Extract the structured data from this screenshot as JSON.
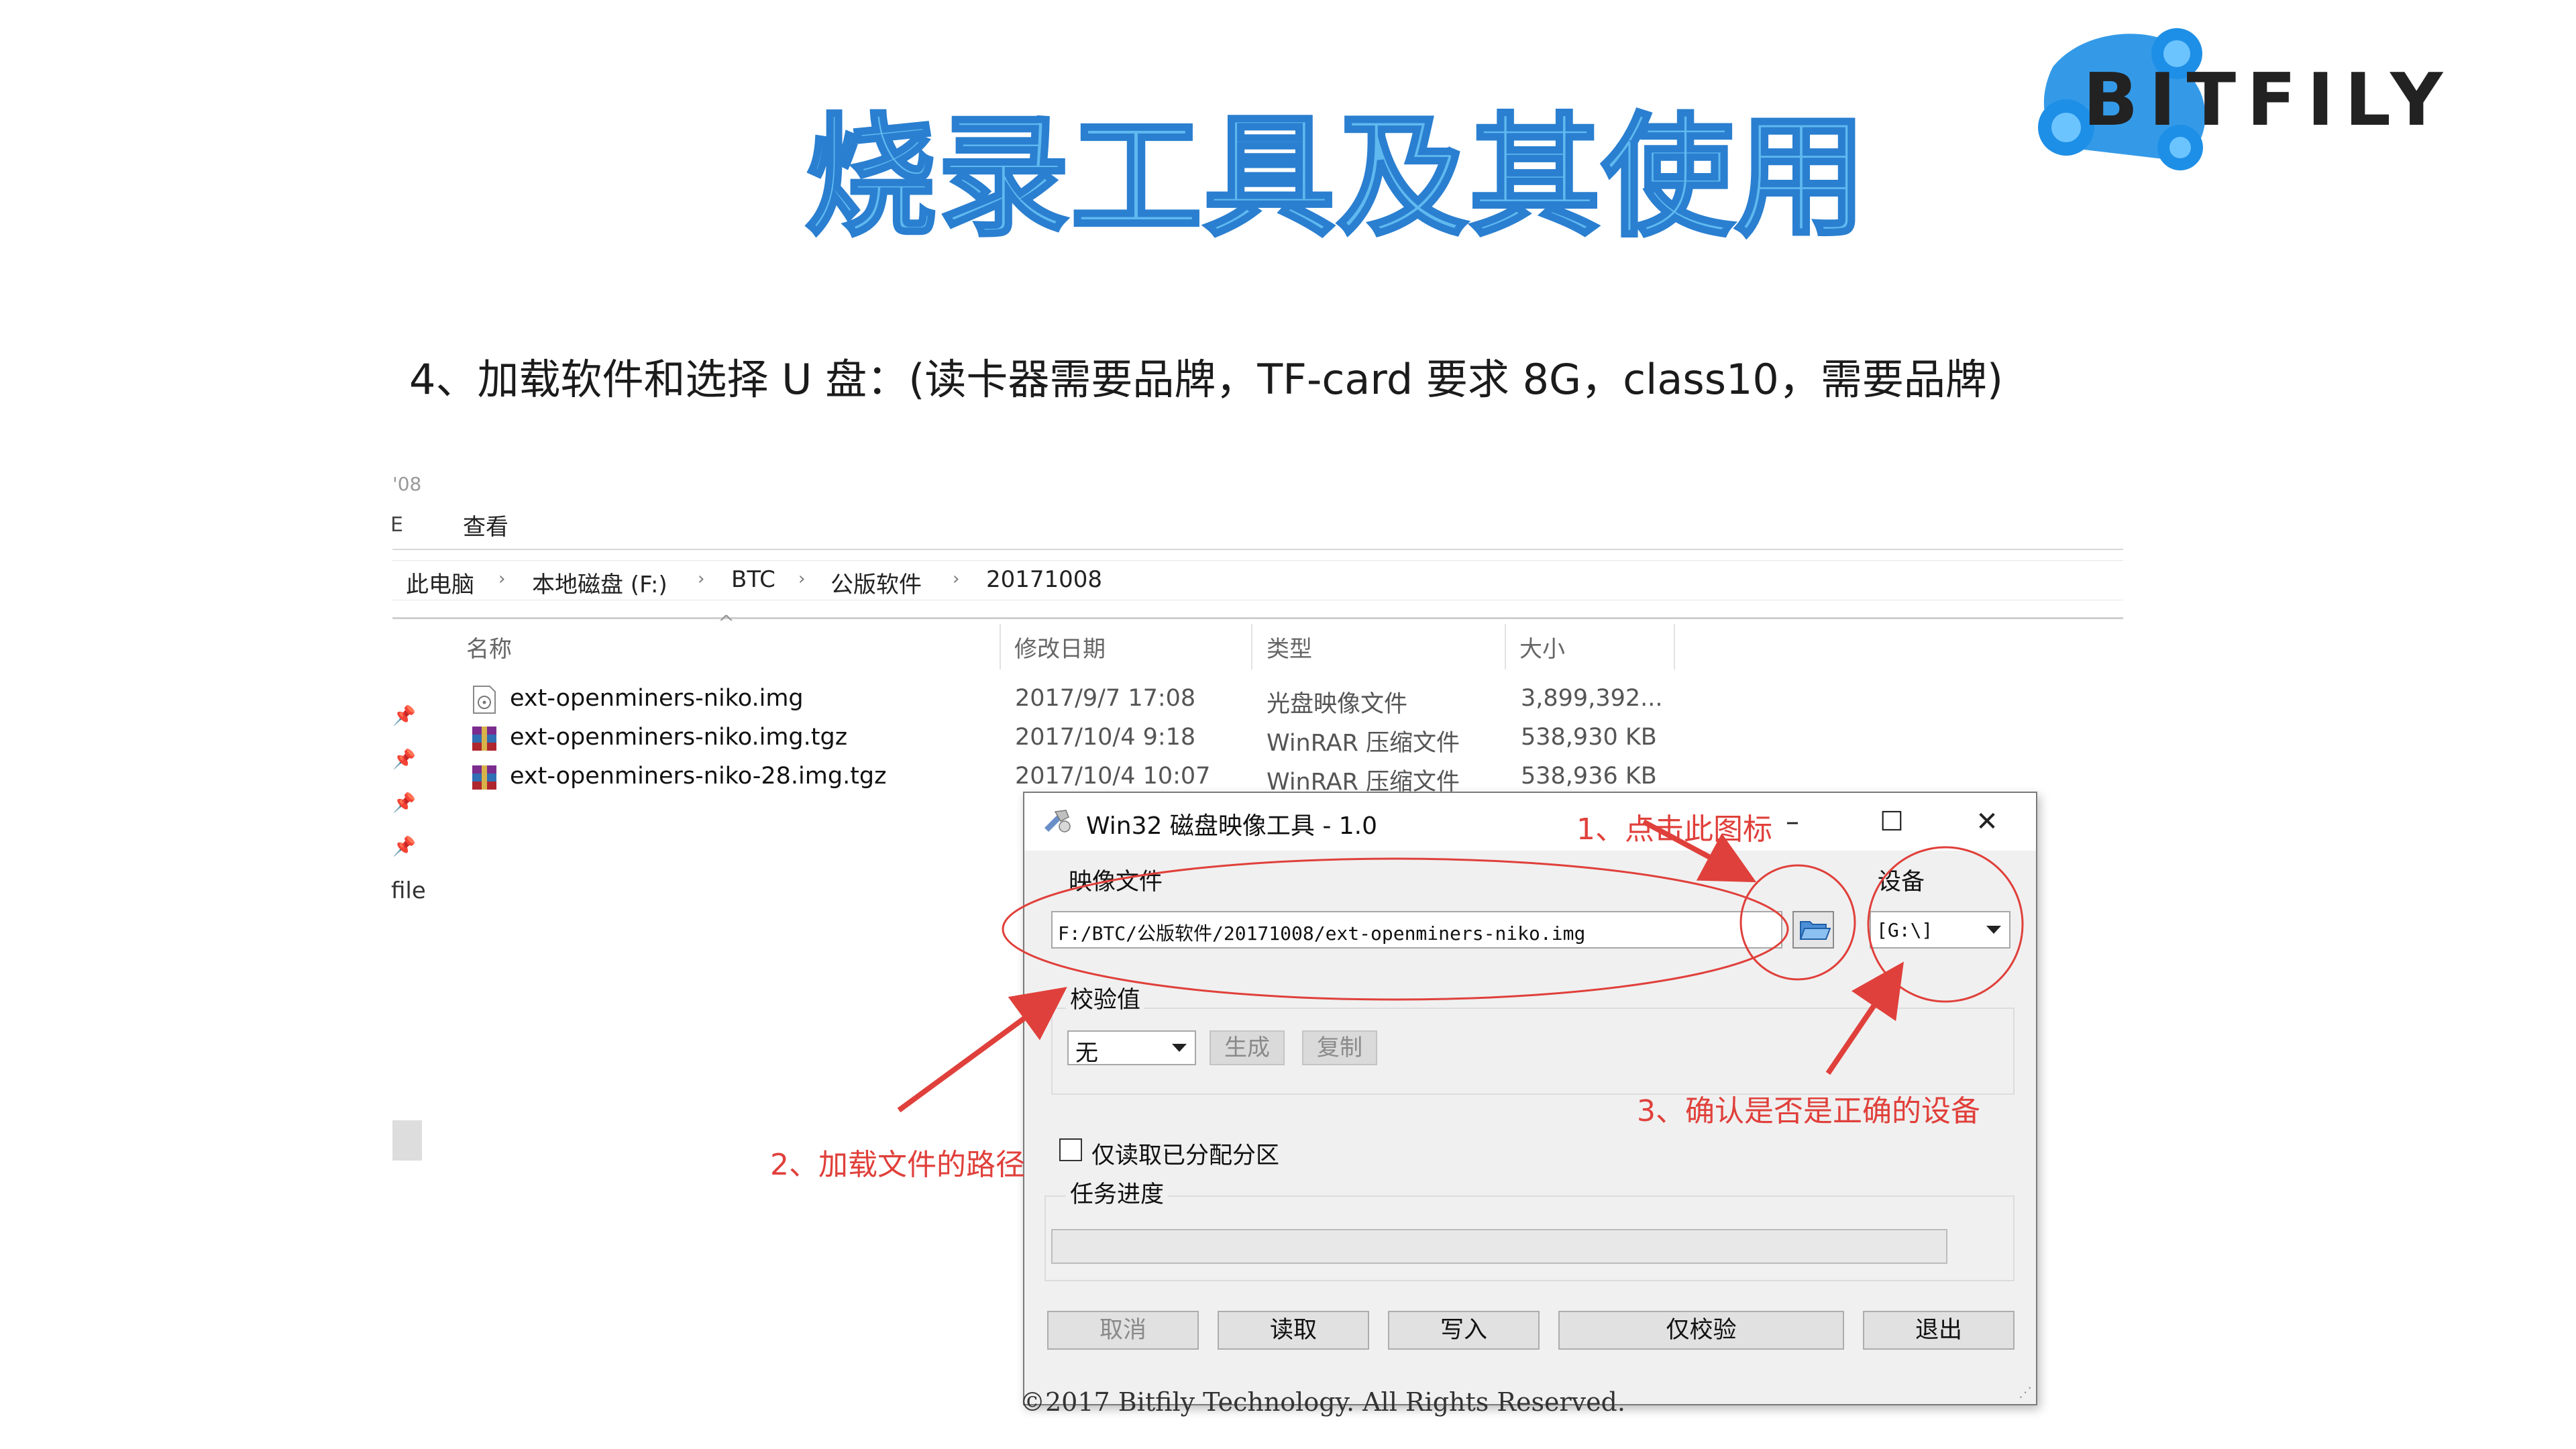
{
  "slide": {
    "title": "烧录工具及其使用",
    "subtitle": "4、加载软件和选择 U 盘：(读卡器需要品牌，TF-card 要求 8G，class10，需要品牌)",
    "logo_text": "BITFILY",
    "footer": "©2017 Bitfily Technology. All Rights Reserved.",
    "colors": {
      "title_fill": "#5fb9ef",
      "title_stroke": "#2a7fd0",
      "logo_blue": "#1e8fe6",
      "annotation_red": "#e0403b"
    }
  },
  "explorer": {
    "fragment_top": "'08",
    "fragment_left": "E",
    "ribbon_view": "查看",
    "breadcrumb": [
      "此电脑",
      "本地磁盘 (F:)",
      "BTC",
      "公版软件",
      "20171008"
    ],
    "columns": {
      "name": "名称",
      "date": "修改日期",
      "type": "类型",
      "size": "大小"
    },
    "side_fragment": "file",
    "files": [
      {
        "name": "ext-openminers-niko.img",
        "date": "2017/9/7 17:08",
        "type": "光盘映像文件",
        "size": "3,899,392...",
        "icon": "disc-image-icon"
      },
      {
        "name": "ext-openminers-niko.img.tgz",
        "date": "2017/10/4 9:18",
        "type": "WinRAR 压缩文件",
        "size": "538,930 KB",
        "icon": "winrar-archive-icon"
      },
      {
        "name": "ext-openminers-niko-28.img.tgz",
        "date": "2017/10/4 10:07",
        "type": "WinRAR 压缩文件",
        "size": "538,936 KB",
        "icon": "winrar-archive-icon"
      }
    ]
  },
  "dialog": {
    "title": "Win32 磁盘映像工具 - 1.0",
    "image_file_label": "映像文件",
    "image_path": "F:/BTC/公版软件/20171008/ext-openminers-niko.img",
    "device_label": "设备",
    "device_value": "[G:\\]",
    "hash_label": "校验值",
    "hash_value": "无",
    "generate_label": "生成",
    "copy_label": "复制",
    "read_only_label": "仅读取已分配分区",
    "progress_label": "任务进度",
    "progress_fraction": 0,
    "buttons": {
      "cancel": "取消",
      "read": "读取",
      "write": "写入",
      "verify": "仅校验",
      "exit": "退出"
    },
    "window": {
      "minimize": "–",
      "maximize": "☐",
      "close": "✕"
    }
  },
  "annotations": {
    "step1": "1、点击此图标",
    "step2": "2、加载文件的路径",
    "step3": "3、确认是否是正确的设备"
  }
}
